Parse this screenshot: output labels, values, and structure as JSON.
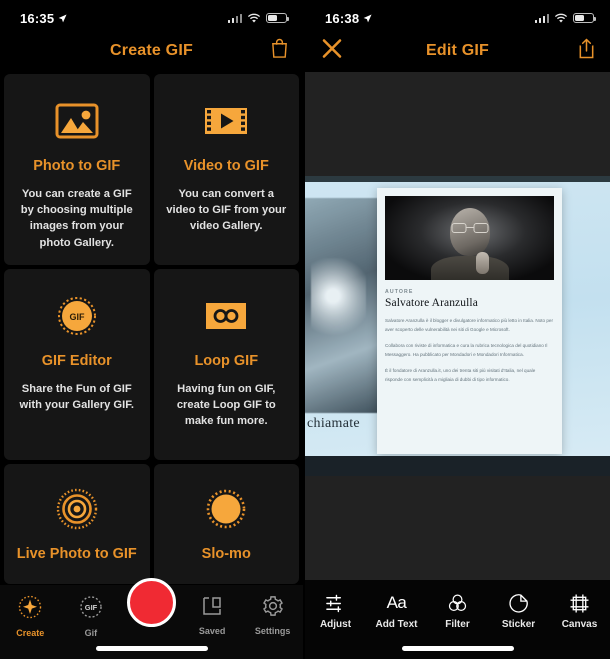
{
  "accent": "#e8922a",
  "record_color": "#f02a33",
  "left_phone": {
    "status": {
      "time": "16:35",
      "location_icon": "location-arrow-icon"
    },
    "nav": {
      "title": "Create GIF",
      "right_icon": "shopping-bag-icon"
    },
    "cards": [
      {
        "icon": "photo-image-icon",
        "title": "Photo to GIF",
        "desc": "You can create a GIF by choosing multiple images from your photo Gallery."
      },
      {
        "icon": "video-film-icon",
        "title": "Video to GIF",
        "desc": "You can convert a video to GIF from your video Gallery."
      },
      {
        "icon": "gif-badge-icon",
        "title": "GIF Editor",
        "desc": "Share the Fun of GIF with your Gallery GIF."
      },
      {
        "icon": "infinity-loop-icon",
        "title": "Loop GIF",
        "desc": "Having fun on GIF, create Loop GIF to make fun more."
      },
      {
        "icon": "live-photo-icon",
        "title": "Live Photo to GIF",
        "desc": ""
      },
      {
        "icon": "slomo-circle-icon",
        "title": "Slo-mo",
        "desc": ""
      }
    ],
    "tabs": [
      {
        "label": "Create",
        "icon": "sparkle-star-icon",
        "active": true
      },
      {
        "label": "Gif",
        "icon": "gif-circle-icon",
        "active": false
      },
      {
        "label": "Saved",
        "icon": "save-box-icon",
        "active": false
      },
      {
        "label": "Settings",
        "icon": "gear-icon",
        "active": false
      }
    ],
    "record_button": "record-button"
  },
  "right_phone": {
    "status": {
      "time": "16:38",
      "location_icon": "location-arrow-icon"
    },
    "nav": {
      "title": "Edit GIF",
      "left_icon": "close-x-icon",
      "right_icon": "share-upload-icon"
    },
    "photo": {
      "side_caption": "chiamate",
      "sheet": {
        "kicker": "AUTORE",
        "name": "Salvatore Aranzulla",
        "paragraphs": [
          "Salvatore Aranzulla è il blogger e divulgatore informatico più letto in Italia. Noto per aver scoperto delle vulnerabilità nei siti di Google e Microsoft.",
          "Collabora con riviste di informatica e cura la rubrica tecnologica del quotidiano Il Messaggero. Ha pubblicato per Mondadori e Mondadori Informatica.",
          "È il fondatore di Aranzulla.it, uno dei trenta siti più visitati d'Italia, nel quale risponde con semplicità a migliaia di dubbi di tipo informatico."
        ]
      }
    },
    "tools": [
      {
        "label": "Adjust",
        "icon": "sliders-icon"
      },
      {
        "label": "Add Text",
        "icon": "text-aa-icon"
      },
      {
        "label": "Filter",
        "icon": "filter-circles-icon"
      },
      {
        "label": "Sticker",
        "icon": "sticker-icon"
      },
      {
        "label": "Canvas",
        "icon": "canvas-crop-icon"
      }
    ]
  }
}
